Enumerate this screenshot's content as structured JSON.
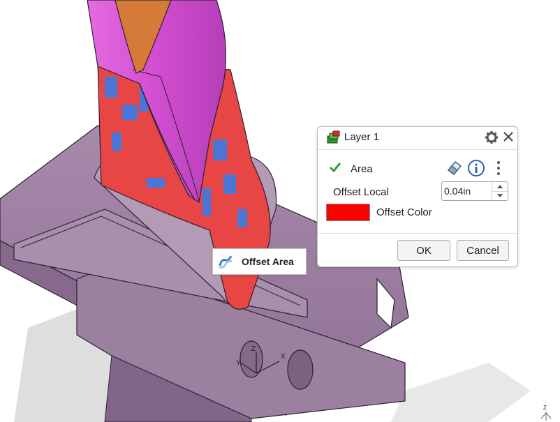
{
  "dialog": {
    "title": "Layer 1",
    "area_label": "Area",
    "offset_local_label": "Offset Local",
    "offset_local_value": "0.04in",
    "offset_color_label": "Offset Color",
    "offset_color": "#ff0000",
    "ok_label": "OK",
    "cancel_label": "Cancel"
  },
  "tooltip": {
    "label": "Offset Area"
  },
  "triad": {
    "x": "X",
    "y": "Y",
    "z": "Z"
  },
  "corner_triad": {
    "z": "Z"
  },
  "colors": {
    "part_body": "#9b7f9f",
    "surface_magenta": "#d94ed6",
    "surface_orange": "#d67a3a",
    "offset_red": "#e84545",
    "offset_blue": "#4b76d6",
    "check_green": "#2e9e3e"
  }
}
